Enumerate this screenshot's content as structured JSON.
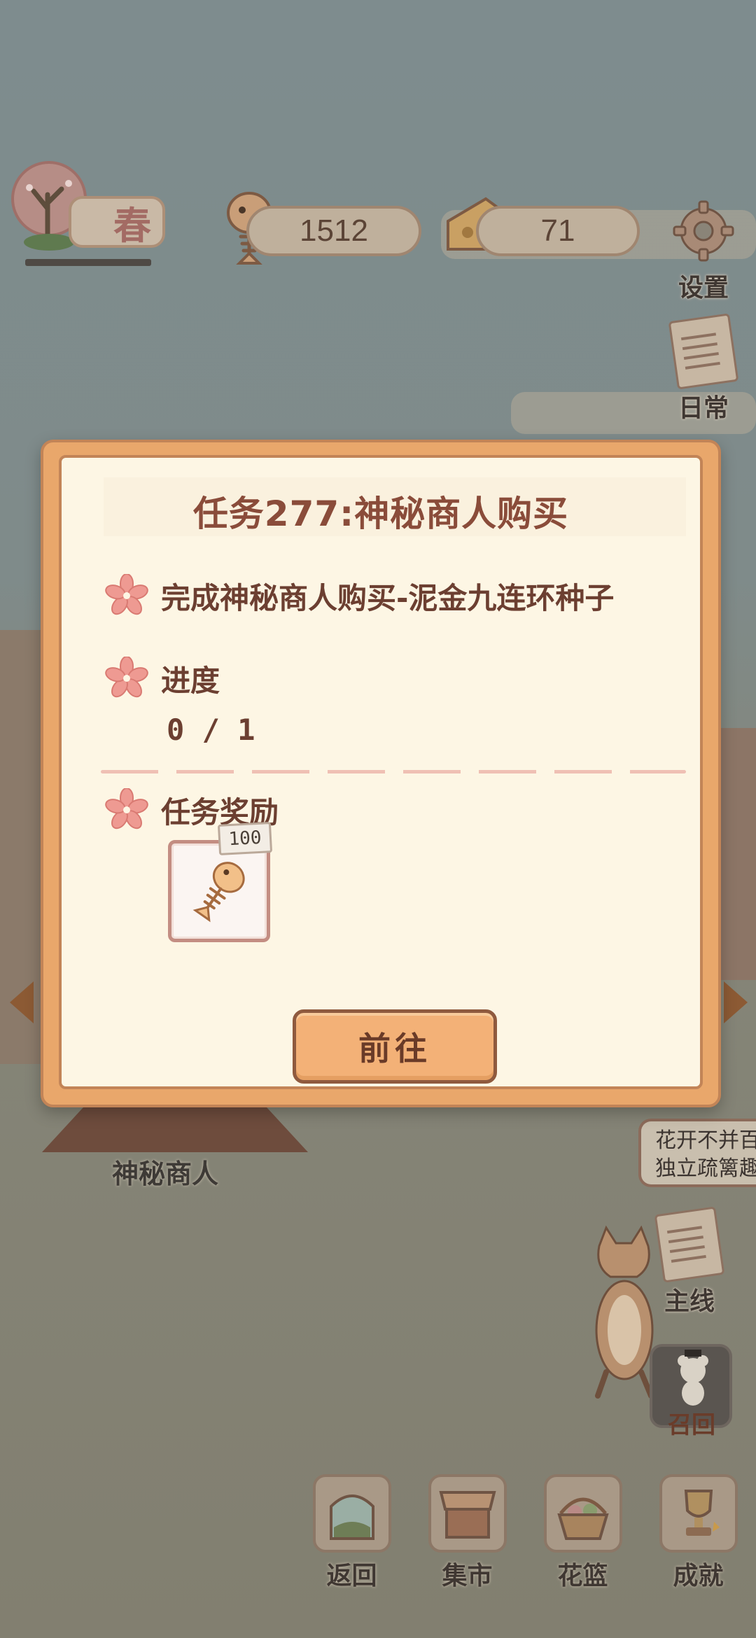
{
  "hud": {
    "season": "春",
    "fish_count": "1512",
    "cheese_count": "71"
  },
  "side_menu": {
    "settings_label": "设置",
    "daily_label": "日常",
    "main_label": "主线",
    "mouse_label": "召回"
  },
  "scene": {
    "npc_name": "神秘商人",
    "speech_line1": "花开不并百",
    "speech_line2": "独立疏篱趣"
  },
  "dialog": {
    "title": "任务277:神秘商人购买",
    "task_description": "完成神秘商人购买-泥金九连环种子",
    "progress_label": "进度",
    "progress_value": "0 / 1",
    "reward_label": "任务奖励",
    "reward_amount": "100",
    "reward_icon": "fishbone-icon",
    "go_button": "前往"
  },
  "bottom_nav": [
    {
      "label": "返回",
      "icon": "window-icon"
    },
    {
      "label": "集市",
      "icon": "market-stall-icon"
    },
    {
      "label": "花篮",
      "icon": "flower-basket-icon"
    },
    {
      "label": "成就",
      "icon": "trophy-icon"
    }
  ],
  "colors": {
    "dialog_frame": "#e9a76b",
    "dialog_paper": "#fdf6e4",
    "text_brown": "#6c3f31",
    "button_orange": "#f3b177"
  }
}
